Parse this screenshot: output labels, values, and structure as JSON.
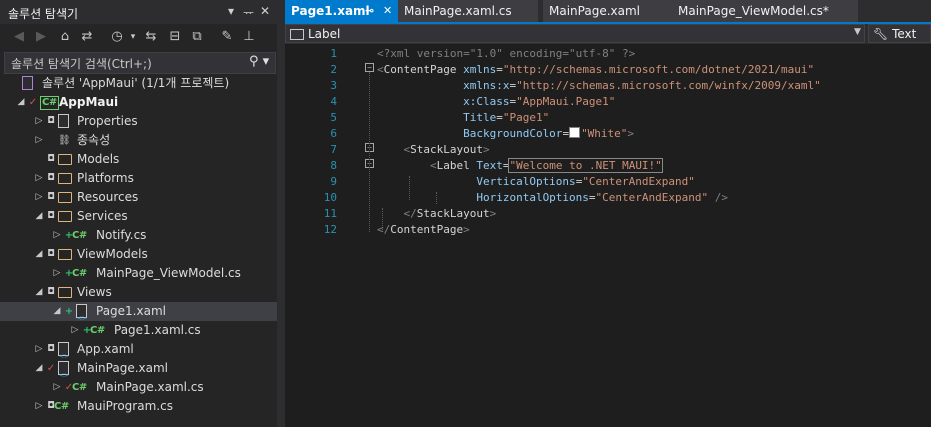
{
  "solution_explorer": {
    "title": "솔루션 탐색기",
    "header_icons": [
      "dropdown-icon",
      "pin-icon",
      "close-icon"
    ],
    "search_placeholder": "솔루션 탐색기 검색(Ctrl+;)",
    "tree": [
      {
        "label": "솔루션 'AppMaui' (1/1개 프로젝트)",
        "icon": "solution-icon",
        "status": ""
      },
      {
        "label": "AppMaui",
        "icon": "csharp-project-icon",
        "status": "check"
      },
      {
        "label": "Properties",
        "icon": "properties-icon",
        "status": "lock"
      },
      {
        "label": "종속성",
        "icon": "dependencies-icon",
        "status": ""
      },
      {
        "label": "Models",
        "icon": "folder-icon",
        "status": "lock"
      },
      {
        "label": "Platforms",
        "icon": "folder-icon",
        "status": "lock"
      },
      {
        "label": "Resources",
        "icon": "folder-icon",
        "status": "lock"
      },
      {
        "label": "Services",
        "icon": "folder-icon",
        "status": "lock"
      },
      {
        "label": "Notify.cs",
        "icon": "csharp-file-icon",
        "status": "plus"
      },
      {
        "label": "ViewModels",
        "icon": "folder-icon",
        "status": "lock"
      },
      {
        "label": "MainPage_ViewModel.cs",
        "icon": "csharp-file-icon",
        "status": "plus"
      },
      {
        "label": "Views",
        "icon": "folder-icon",
        "status": "lock"
      },
      {
        "label": "Page1.xaml",
        "icon": "xaml-file-icon",
        "status": "plus"
      },
      {
        "label": "Page1.xaml.cs",
        "icon": "csharp-file-icon",
        "status": "plus"
      },
      {
        "label": "App.xaml",
        "icon": "xaml-file-icon",
        "status": "lock"
      },
      {
        "label": "MainPage.xaml",
        "icon": "xaml-file-icon",
        "status": "check"
      },
      {
        "label": "MainPage.xaml.cs",
        "icon": "csharp-file-icon",
        "status": "check"
      },
      {
        "label": "MauiProgram.cs",
        "icon": "csharp-file-icon",
        "status": "lock"
      }
    ]
  },
  "tabs": [
    {
      "label": "Page1.xaml",
      "active": true
    },
    {
      "label": "MainPage.xaml.cs",
      "active": false
    },
    {
      "label": "MainPage.xaml",
      "active": false
    },
    {
      "label": "MainPage_ViewModel.cs*",
      "active": false
    }
  ],
  "navbar": {
    "left": "Label",
    "right": "Text"
  },
  "code": {
    "line_numbers": [
      "1",
      "2",
      "3",
      "4",
      "5",
      "6",
      "7",
      "8",
      "9",
      "10",
      "11",
      "12"
    ],
    "lines": [
      [
        {
          "t": "<?xml version=\"1.0\" encoding=\"utf-8\" ?>",
          "c": "d"
        }
      ],
      [
        {
          "t": "<",
          "c": "d"
        },
        {
          "t": "ContentPage",
          "c": "p"
        },
        {
          "t": " xmlns",
          "c": "a"
        },
        {
          "t": "=",
          "c": "p"
        },
        {
          "t": "\"http://schemas.microsoft.com/dotnet/2021/maui\"",
          "c": "v"
        }
      ],
      [
        {
          "t": "             xmlns:x",
          "c": "a"
        },
        {
          "t": "=",
          "c": "p"
        },
        {
          "t": "\"http://schemas.microsoft.com/winfx/2009/xaml\"",
          "c": "v"
        }
      ],
      [
        {
          "t": "             x:Class",
          "c": "a"
        },
        {
          "t": "=",
          "c": "p"
        },
        {
          "t": "\"AppMaui.Page1\"",
          "c": "v"
        }
      ],
      [
        {
          "t": "             Title",
          "c": "a"
        },
        {
          "t": "=",
          "c": "p"
        },
        {
          "t": "\"Page1\"",
          "c": "v"
        }
      ],
      [
        {
          "t": "             BackgroundColor",
          "c": "a"
        },
        {
          "t": "=",
          "c": "p"
        },
        {
          "t": "",
          "c": "swatch"
        },
        {
          "t": "\"White\"",
          "c": "v"
        },
        {
          "t": ">",
          "c": "d"
        }
      ],
      [
        {
          "t": "    <",
          "c": "d"
        },
        {
          "t": "StackLayout",
          "c": "p"
        },
        {
          "t": ">",
          "c": "d"
        }
      ],
      [
        {
          "t": "        <",
          "c": "d"
        },
        {
          "t": "Label",
          "c": "p"
        },
        {
          "t": " Text",
          "c": "a"
        },
        {
          "t": "=",
          "c": "p"
        },
        {
          "t": "\"Welcome to .NET MAUI!\"",
          "c": "vh"
        },
        {
          "t": "",
          "c": "caret"
        }
      ],
      [
        {
          "t": "               VerticalOptions",
          "c": "a"
        },
        {
          "t": "=",
          "c": "p"
        },
        {
          "t": "\"CenterAndExpand\"",
          "c": "v"
        }
      ],
      [
        {
          "t": "               HorizontalOptions",
          "c": "a"
        },
        {
          "t": "=",
          "c": "p"
        },
        {
          "t": "\"CenterAndExpand\"",
          "c": "v"
        },
        {
          "t": " />",
          "c": "d"
        }
      ],
      [
        {
          "t": "    </",
          "c": "d"
        },
        {
          "t": "StackLayout",
          "c": "p"
        },
        {
          "t": ">",
          "c": "d"
        }
      ],
      [
        {
          "t": "</",
          "c": "d"
        },
        {
          "t": "ContentPage",
          "c": "p"
        },
        {
          "t": ">",
          "c": "d"
        }
      ]
    ]
  }
}
